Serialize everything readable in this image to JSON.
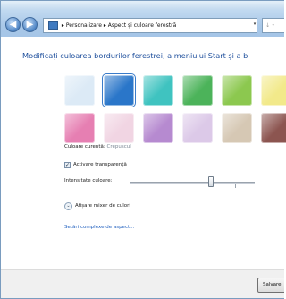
{
  "window": {
    "breadcrumb": [
      "Personalizare",
      "Aspect și culoare ferestră"
    ],
    "breadcrumb_sep": "▸",
    "back_glyph": "◀",
    "forward_glyph": "▶",
    "dropdown_glyph": "▾",
    "search_text": "↓ •"
  },
  "main": {
    "heading": "Modificați culoarea bordurilor ferestrei, a meniului Start și a b",
    "swatches_row1": [
      "#dceaf6",
      "#2a76c9",
      "#3fc3c0",
      "#4cb35a",
      "#8cc84f",
      "#f2e98a"
    ],
    "swatches_row2": [
      "#e67fb2",
      "#f1d5e3",
      "#b68ad0",
      "#dcc9e8",
      "#d6c8b4",
      "#8c5550"
    ],
    "selected_swatch": 1,
    "current_color_label": "Culoare curentă:",
    "current_color_value": "Crepuscul",
    "transparency_label": "Activare transparență",
    "transparency_checked": true,
    "checkbox_glyph": "✓",
    "intensity_label": "Intensitate culoare:",
    "intensity_value": 0.65,
    "mixer_label": "Afișare mixer de culori",
    "expander_glyph": "⌄",
    "advanced_link": "Setări complexe de aspect..."
  },
  "footer": {
    "save_label": "Salvare"
  }
}
